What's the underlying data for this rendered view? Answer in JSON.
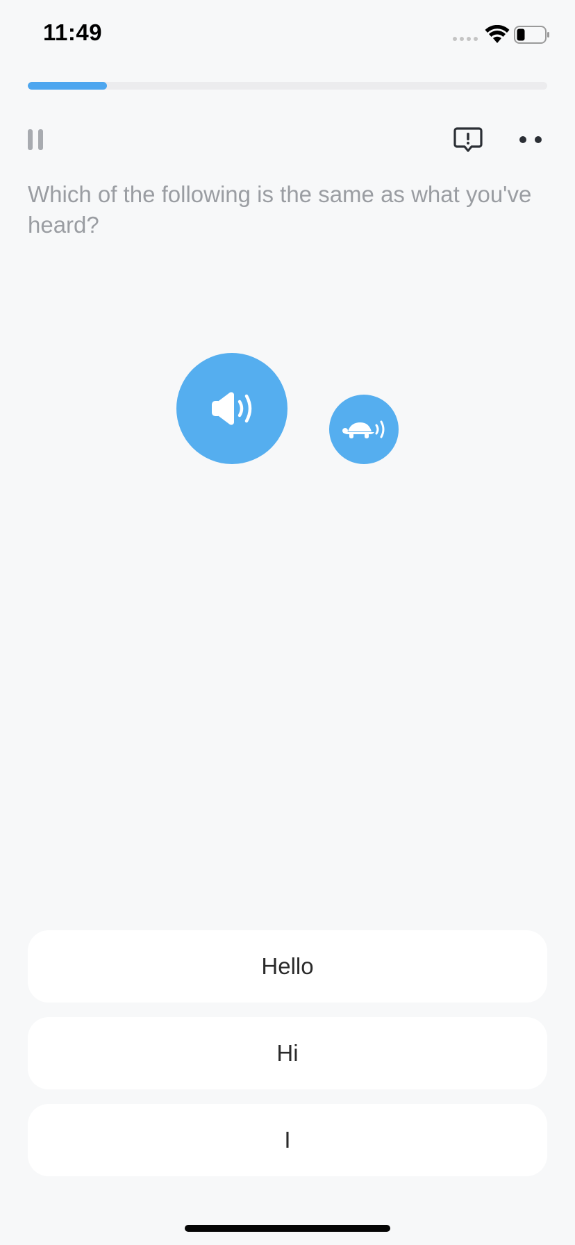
{
  "status_bar": {
    "time": "11:49"
  },
  "progress": {
    "value_fraction": 0.15,
    "color": "#4da6ef"
  },
  "toolbar": {
    "pause_icon": "pause-icon",
    "report_icon": "report-icon",
    "more_icon": "more-icon"
  },
  "question": {
    "text": "Which of the following is the same as what you've heard?"
  },
  "audio": {
    "play_icon": "speaker-icon",
    "slow_icon": "turtle-icon",
    "accent": "#55aeef"
  },
  "answers": [
    {
      "label": "Hello"
    },
    {
      "label": "Hi"
    },
    {
      "label": "I"
    }
  ]
}
